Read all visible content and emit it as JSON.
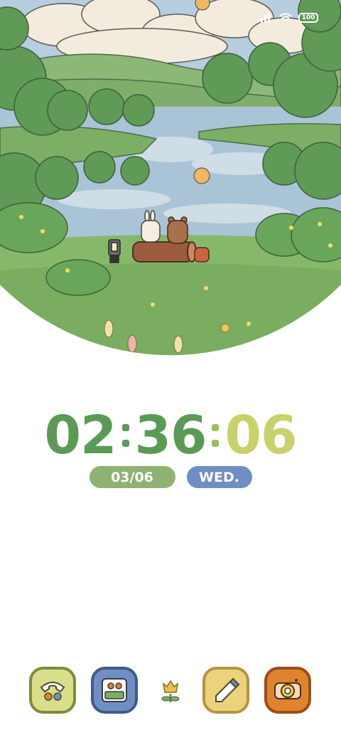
{
  "status_bar": {
    "battery": "100"
  },
  "clock": {
    "hours": "02",
    "minutes": "36",
    "seconds": "06"
  },
  "date": {
    "date_label": "03/06",
    "weekday_label": "WED."
  },
  "dock": {
    "apps": [
      {
        "icon": "phone-icon",
        "color": "#d8de8a"
      },
      {
        "icon": "gallery-icon",
        "color": "#6f8ec4"
      },
      {
        "icon": "flower-icon",
        "color": "#e8c04a"
      },
      {
        "icon": "notes-icon",
        "color": "#ecd27a"
      },
      {
        "icon": "camera-icon",
        "color": "#e0832f"
      }
    ]
  },
  "colors": {
    "green": "#5a9a55",
    "lime": "#c9d26a",
    "date_pill": "#8fb272",
    "day_pill": "#6f8ec4"
  }
}
